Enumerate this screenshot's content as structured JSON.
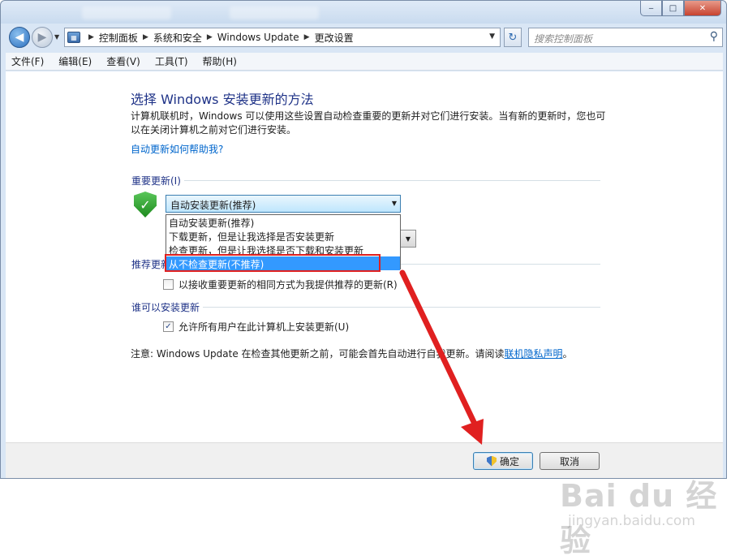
{
  "window": {
    "ghost_tabs": [
      "添加控制面板",
      "添加视频"
    ],
    "caption": {
      "minimize": "‒",
      "maximize": "□",
      "close": "✕"
    }
  },
  "navigation": {
    "back_icon": "arrow-left-icon",
    "forward_icon": "arrow-right-icon",
    "breadcrumbs": [
      "控制面板",
      "系统和安全",
      "Windows Update",
      "更改设置"
    ],
    "search_placeholder": "搜索控制面板"
  },
  "menu": {
    "items": [
      "文件(F)",
      "编辑(E)",
      "查看(V)",
      "工具(T)",
      "帮助(H)"
    ]
  },
  "content": {
    "heading": "选择 Windows 安装更新的方法",
    "description": "计算机联机时，Windows 可以使用这些设置自动检查重要的更新并对它们进行安装。当有新的更新时，您也可以在关闭计算机之前对它们进行安装。",
    "help_link": "自动更新如何帮助我?",
    "important_updates": {
      "label": "重要更新(I)",
      "selected": "自动安装更新(推荐)",
      "options": [
        "自动安装更新(推荐)",
        "下载更新，但是让我选择是否安装更新",
        "检查更新，但是让我选择是否下载和安装更新",
        "从不检查更新(不推荐)"
      ],
      "highlighted_index": 3
    },
    "recommended_updates": {
      "label": "推荐更新",
      "checkbox_label": "以接收重要更新的相同方式为我提供推荐的更新(R)",
      "checked": false
    },
    "who_can_install": {
      "label": "谁可以安装更新",
      "checkbox_label": "允许所有用户在此计算机上安装更新(U)",
      "checked": true
    },
    "note_prefix": "注意: Windows Update 在检查其他更新之前，可能会首先自动进行自我更新。请阅读",
    "note_link": "联机隐私声明",
    "note_suffix": "。"
  },
  "footer": {
    "ok_label": "确定",
    "cancel_label": "取消"
  },
  "annotation": {
    "color": "#e02020"
  },
  "watermark": {
    "logo": "Bai du 经验",
    "url": "jingyan.baidu.com"
  }
}
